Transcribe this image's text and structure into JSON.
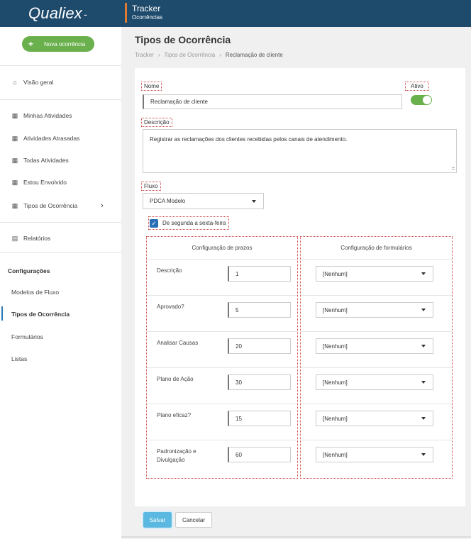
{
  "header": {
    "logo": "Qualiex",
    "app_name": "Tracker",
    "app_sub": "Ocorrências",
    "accent": "#e07a30",
    "bg": "#1e4a6b"
  },
  "sidebar": {
    "new_button": "Nova ocorrência",
    "items": [
      {
        "label": "Visão geral",
        "icon": "home-icon"
      },
      {
        "label": "Minhas Atividades",
        "icon": "grid-icon"
      },
      {
        "label": "Atividades Atrasadas",
        "icon": "grid-icon"
      },
      {
        "label": "Todas Atividades",
        "icon": "grid-icon"
      },
      {
        "label": "Estou Envolvido",
        "icon": "grid-icon"
      },
      {
        "label": "Tipos de Ocorrência",
        "icon": "grid-icon"
      },
      {
        "label": "Relatórios",
        "icon": "document-icon"
      }
    ],
    "config_heading": "Configurações",
    "config_items": [
      "Modelos de Fluxo",
      "Tipos de Ocorrência",
      "Formulários",
      "Listas"
    ],
    "active_config": "Tipos de Ocorrência"
  },
  "main": {
    "title": "Tipos de Ocorrência",
    "breadcrumb": [
      "Tracker",
      "Tipos de Ocorrência",
      "Reclamação de cliente"
    ]
  },
  "form": {
    "nome_label": "Nome",
    "nome_value": "Reclamação de cliente",
    "ativo_label": "Ativo",
    "ativo": true,
    "descricao_label": "Descrição",
    "descricao_value": "Registrar as reclamações dos clientes recebidas pelos canais de atendimento.",
    "fluxo_label": "Fluxo",
    "fluxo_value": "PDCA Modelo",
    "checkbox_label": "De segunda a sexta-feira",
    "checkbox_checked": true
  },
  "prazos": {
    "heading": "Configuração de prazos",
    "rows": [
      {
        "label": "Descrição",
        "value": "1"
      },
      {
        "label": "Aprovado?",
        "value": "5"
      },
      {
        "label": "Analisar Causas",
        "value": "20"
      },
      {
        "label": "Plano de Ação",
        "value": "30"
      },
      {
        "label": "Plano eficaz?",
        "value": "15"
      },
      {
        "label": "Padronização e Divulgação",
        "value": "60"
      }
    ]
  },
  "formularios": {
    "heading": "Configuração de formulários",
    "options": [
      "[Nenhum]",
      "[Nenhum]",
      "[Nenhum]",
      "[Nenhum]",
      "[Nenhum]",
      "[Nenhum]"
    ]
  },
  "footer": {
    "save": "Salvar",
    "cancel": "Cancelar"
  }
}
